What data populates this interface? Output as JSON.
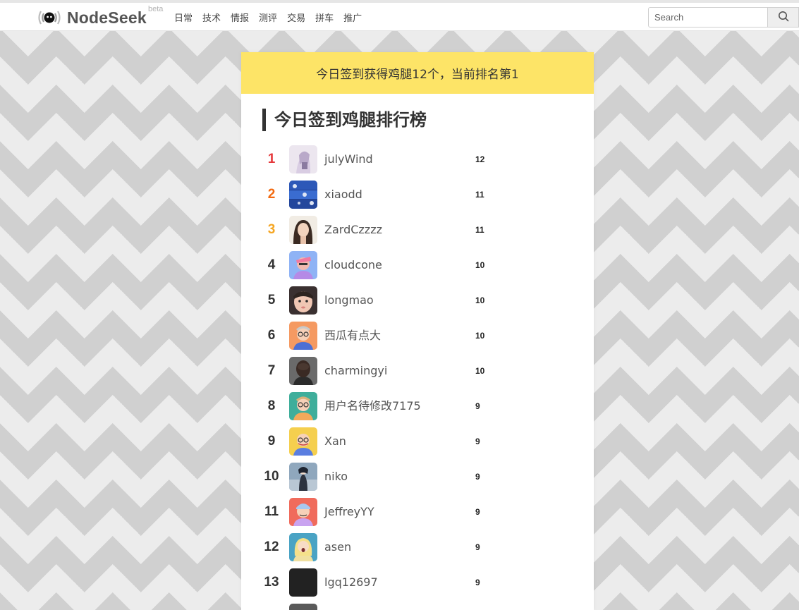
{
  "header": {
    "logo_text": "NodeSeek",
    "logo_badge": "beta",
    "nav": [
      "日常",
      "技术",
      "情报",
      "测评",
      "交易",
      "拼车",
      "推广"
    ],
    "search_placeholder": "Search"
  },
  "banner": {
    "message": "今日签到获得鸡腿12个，当前排名第1"
  },
  "leaderboard": {
    "title": "今日签到鸡腿排行榜",
    "entries": [
      {
        "rank": "1",
        "name": "julyWind",
        "score": "12"
      },
      {
        "rank": "2",
        "name": "xiaodd",
        "score": "11"
      },
      {
        "rank": "3",
        "name": "ZardCzzzz",
        "score": "11"
      },
      {
        "rank": "4",
        "name": "cloudcone",
        "score": "10"
      },
      {
        "rank": "5",
        "name": "longmao",
        "score": "10"
      },
      {
        "rank": "6",
        "name": "西瓜有点大",
        "score": "10"
      },
      {
        "rank": "7",
        "name": "charmingyi",
        "score": "10"
      },
      {
        "rank": "8",
        "name": "用户名待修改7175",
        "score": "9"
      },
      {
        "rank": "9",
        "name": "Xan",
        "score": "9"
      },
      {
        "rank": "10",
        "name": "niko",
        "score": "9"
      },
      {
        "rank": "11",
        "name": "JeffreyYY",
        "score": "9"
      },
      {
        "rank": "12",
        "name": "asen",
        "score": "9"
      },
      {
        "rank": "13",
        "name": "lgq12697",
        "score": "9"
      }
    ]
  },
  "colors": {
    "banner_bg": "#fde467",
    "rank1": "#e5383b",
    "rank2": "#f36a10",
    "rank3": "#f5a623",
    "text": "#333333"
  },
  "icons": {
    "logo": "radio-wave-face-icon",
    "search": "search-icon"
  }
}
